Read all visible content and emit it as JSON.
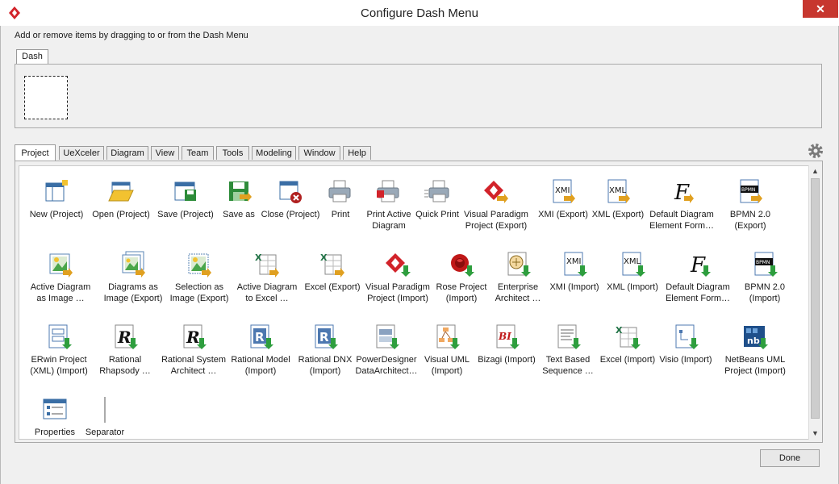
{
  "window": {
    "title": "Configure Dash Menu",
    "close_symbol": "✕",
    "instruction": "Add or remove items by dragging to or from the Dash Menu"
  },
  "dash": {
    "tab_label": "Dash"
  },
  "tabs": [
    {
      "label": "Project",
      "active": true
    },
    {
      "label": "UeXceler"
    },
    {
      "label": "Diagram"
    },
    {
      "label": "View"
    },
    {
      "label": "Team"
    },
    {
      "label": "Tools"
    },
    {
      "label": "Modeling"
    },
    {
      "label": "Window"
    },
    {
      "label": "Help"
    }
  ],
  "rows": [
    [
      {
        "label": "New (Project)",
        "icon": "new-project-icon"
      },
      {
        "label": "Open (Project)",
        "icon": "open-project-icon"
      },
      {
        "label": "Save (Project)",
        "icon": "save-project-icon"
      },
      {
        "label": "Save as",
        "icon": "save-as-icon"
      },
      {
        "label": "Close (Project)",
        "icon": "close-project-icon"
      },
      {
        "label": "Print",
        "icon": "print-icon"
      },
      {
        "label": "Print Active\nDiagram",
        "icon": "print-active-diagram-icon"
      },
      {
        "label": "Quick Print",
        "icon": "quick-print-icon"
      },
      {
        "label": "Visual Paradigm\nProject (Export)",
        "icon": "vp-export-icon"
      },
      {
        "label": "XMI (Export)",
        "icon": "xmi-export-icon"
      },
      {
        "label": "XML (Export)",
        "icon": "xml-export-icon"
      },
      {
        "label": "Default Diagram\nElement Form…",
        "icon": "default-diagram-element-icon"
      },
      {
        "label": "BPMN 2.0\n(Export)",
        "icon": "bpmn-export-icon"
      }
    ],
    [
      {
        "label": "Active Diagram\nas Image …",
        "icon": "active-diagram-image-icon"
      },
      {
        "label": "Diagrams as\nImage (Export)",
        "icon": "diagrams-image-icon"
      },
      {
        "label": "Selection as\nImage (Export)",
        "icon": "selection-image-icon"
      },
      {
        "label": "Active Diagram\nto Excel …",
        "icon": "active-diagram-excel-icon"
      },
      {
        "label": "Excel (Export)",
        "icon": "excel-export-icon"
      },
      {
        "label": "Visual Paradigm\nProject (Import)",
        "icon": "vp-import-icon"
      },
      {
        "label": "Rose Project\n(Import)",
        "icon": "rose-import-icon"
      },
      {
        "label": "Enterprise\nArchitect …",
        "icon": "enterprise-architect-icon"
      },
      {
        "label": "XMI (Import)",
        "icon": "xmi-import-icon"
      },
      {
        "label": "XML (Import)",
        "icon": "xml-import-icon"
      },
      {
        "label": "Default Diagram\nElement Form…",
        "icon": "default-diagram-element-import-icon"
      },
      {
        "label": "BPMN 2.0\n(Import)",
        "icon": "bpmn-import-icon"
      }
    ],
    [
      {
        "label": "ERwin Project\n(XML) (Import)",
        "icon": "erwin-import-icon"
      },
      {
        "label": "Rational\nRhapsody …",
        "icon": "rational-rhapsody-icon"
      },
      {
        "label": "Rational System\nArchitect …",
        "icon": "rational-system-architect-icon"
      },
      {
        "label": "Rational Model\n(Import)",
        "icon": "rational-model-icon"
      },
      {
        "label": "Rational DNX\n(Import)",
        "icon": "rational-dnx-icon"
      },
      {
        "label": "PowerDesigner\nDataArchitect…",
        "icon": "powerdesigner-icon"
      },
      {
        "label": "Visual UML\n(Import)",
        "icon": "visual-uml-icon"
      },
      {
        "label": "Bizagi (Import)",
        "icon": "bizagi-icon"
      },
      {
        "label": "Text Based\nSequence …",
        "icon": "text-sequence-icon"
      },
      {
        "label": "Excel (Import)",
        "icon": "excel-import-icon"
      },
      {
        "label": "Visio (Import)",
        "icon": "visio-import-icon"
      },
      {
        "label": "NetBeans UML\nProject (Import)",
        "icon": "netbeans-import-icon"
      }
    ],
    [
      {
        "label": "Properties",
        "icon": "properties-icon"
      },
      {
        "label": "Separator",
        "icon": "separator-icon"
      }
    ]
  ],
  "done_label": "Done",
  "colors": {
    "close": "#c7372f",
    "vp_red": "#d2232a",
    "excel_green": "#217346",
    "import_arrow": "#2e9e3e",
    "export_arrow": "#e0a020"
  }
}
